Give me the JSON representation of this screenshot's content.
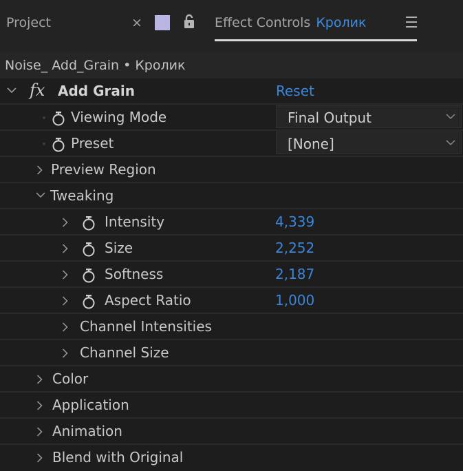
{
  "tabs": {
    "project_label": "Project",
    "close_glyph": "×",
    "effect_controls_label": "Effect Controls",
    "layer_name": "Кролик",
    "label_color": "#b9b6e2",
    "accent_color": "#3c8ce0"
  },
  "breadcrumb": "Noise_ Add_Grain • Кролик",
  "effect": {
    "fx_glyph": "fx",
    "name": "Add Grain",
    "reset_label": "Reset"
  },
  "properties": {
    "viewing_mode": {
      "label": "Viewing Mode",
      "value": "Final Output"
    },
    "preset": {
      "label": "Preset",
      "value": "[None]"
    },
    "preview_region": {
      "label": "Preview Region"
    },
    "tweaking": {
      "label": "Tweaking"
    },
    "intensity": {
      "label": "Intensity",
      "value": "4,339"
    },
    "size": {
      "label": "Size",
      "value": "2,252"
    },
    "softness": {
      "label": "Softness",
      "value": "2,187"
    },
    "aspect_ratio": {
      "label": "Aspect Ratio",
      "value": "1,000"
    },
    "channel_intensities": {
      "label": "Channel Intensities"
    },
    "channel_size": {
      "label": "Channel Size"
    },
    "color": {
      "label": "Color"
    },
    "application": {
      "label": "Application"
    },
    "animation": {
      "label": "Animation"
    },
    "blend_with_original": {
      "label": "Blend with Original"
    }
  },
  "icons": {
    "stopwatch": "stopwatch-icon",
    "expand": "chevron-right-icon",
    "collapse": "chevron-down-icon",
    "lock": "lock-icon",
    "menu": "hamburger-menu-icon",
    "close": "close-icon"
  }
}
